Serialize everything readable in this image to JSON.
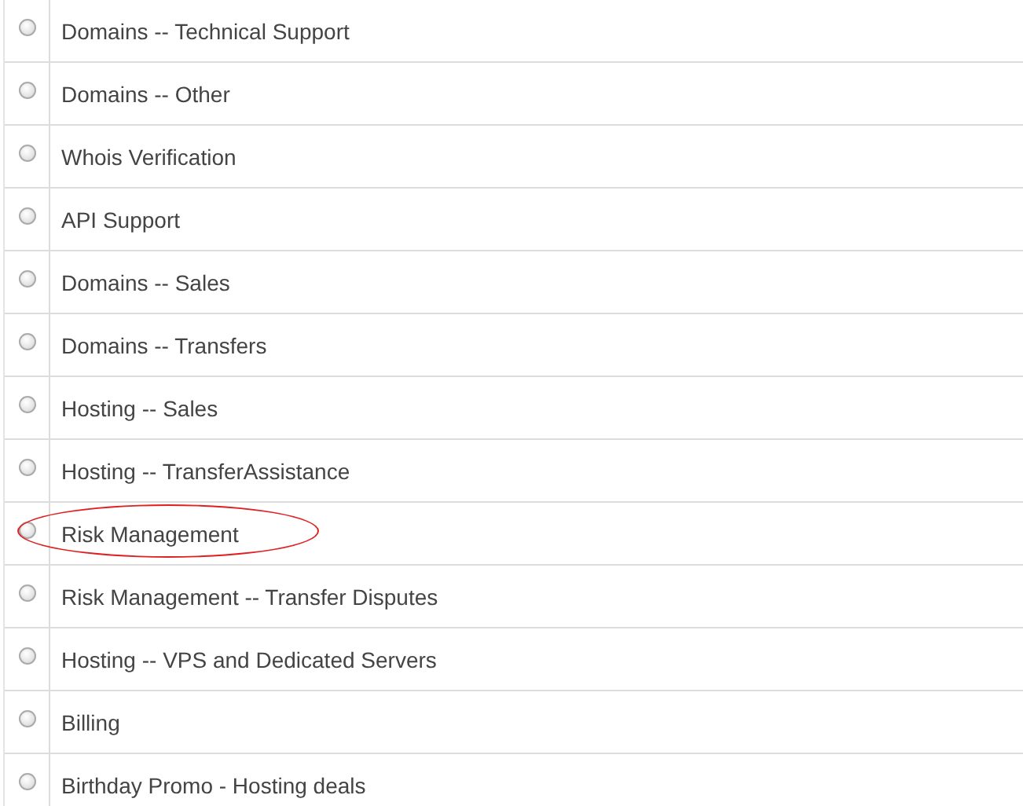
{
  "options": [
    {
      "label": "Domains -- Technical Support",
      "selected": false,
      "circled": false
    },
    {
      "label": "Domains -- Other",
      "selected": false,
      "circled": false
    },
    {
      "label": "Whois Verification",
      "selected": false,
      "circled": false
    },
    {
      "label": "API Support",
      "selected": false,
      "circled": false
    },
    {
      "label": "Domains -- Sales",
      "selected": false,
      "circled": false
    },
    {
      "label": "Domains -- Transfers",
      "selected": false,
      "circled": false
    },
    {
      "label": "Hosting -- Sales",
      "selected": false,
      "circled": false
    },
    {
      "label": "Hosting -- TransferAssistance",
      "selected": false,
      "circled": false
    },
    {
      "label": "Risk Management",
      "selected": false,
      "circled": true
    },
    {
      "label": "Risk Management -- Transfer Disputes",
      "selected": false,
      "circled": false
    },
    {
      "label": "Hosting -- VPS and Dedicated Servers",
      "selected": false,
      "circled": false
    },
    {
      "label": "Billing",
      "selected": false,
      "circled": false
    },
    {
      "label": "Birthday Promo - Hosting deals",
      "selected": false,
      "circled": false
    }
  ]
}
